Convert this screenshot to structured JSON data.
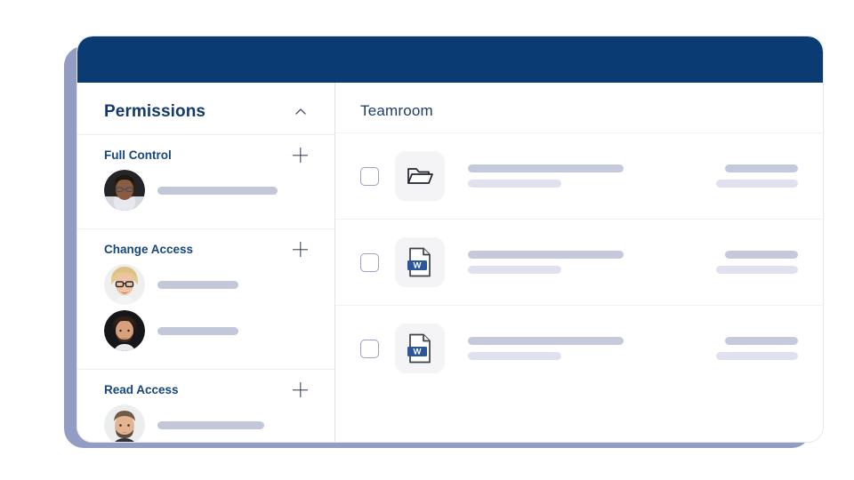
{
  "window": {
    "titlebar_color": "#0b3b73",
    "shadow_color": "#8a94bd",
    "card_background": "#ffffff"
  },
  "sidebar": {
    "title": "Permissions",
    "collapse_icon": "chevron-up-icon",
    "groups": [
      {
        "label": "Full Control",
        "add_icon": "plus-icon",
        "members": [
          {
            "avatar": "woman-glasses-dark-bg",
            "name_bar_width": 135
          }
        ]
      },
      {
        "label": "Change Access",
        "add_icon": "plus-icon",
        "members": [
          {
            "avatar": "blonde-woman-glasses-light-bg",
            "name_bar_width": 91
          },
          {
            "avatar": "bearded-man-dark-bg",
            "name_bar_width": 91
          }
        ]
      },
      {
        "label": "Read Access",
        "add_icon": "plus-icon",
        "members": [
          {
            "avatar": "bearded-man-light-bg",
            "name_bar_width": 120
          }
        ]
      }
    ]
  },
  "main": {
    "title": "Teamroom",
    "rows": [
      {
        "checkbox_checked": false,
        "icon": "folder-icon",
        "title_bar_width": 175,
        "subtitle_bar_width": 105,
        "meta_bar_width": 82,
        "meta_sub_bar_width": 92
      },
      {
        "checkbox_checked": false,
        "icon": "word-document-icon",
        "title_bar_width": 175,
        "subtitle_bar_width": 105,
        "meta_bar_width": 82,
        "meta_sub_bar_width": 92
      },
      {
        "checkbox_checked": false,
        "icon": "word-document-icon",
        "title_bar_width": 175,
        "subtitle_bar_width": 105,
        "meta_bar_width": 82,
        "meta_sub_bar_width": 92
      }
    ]
  },
  "colors": {
    "navy": "#0b3b73",
    "title_blue": "#143a6b",
    "group_label_blue": "#16467f",
    "word_badge_blue": "#2b579a",
    "skeleton_dark": "#c5c9dc",
    "skeleton_light": "#dfe2ee",
    "checkbox_border": "#98a1c6"
  }
}
